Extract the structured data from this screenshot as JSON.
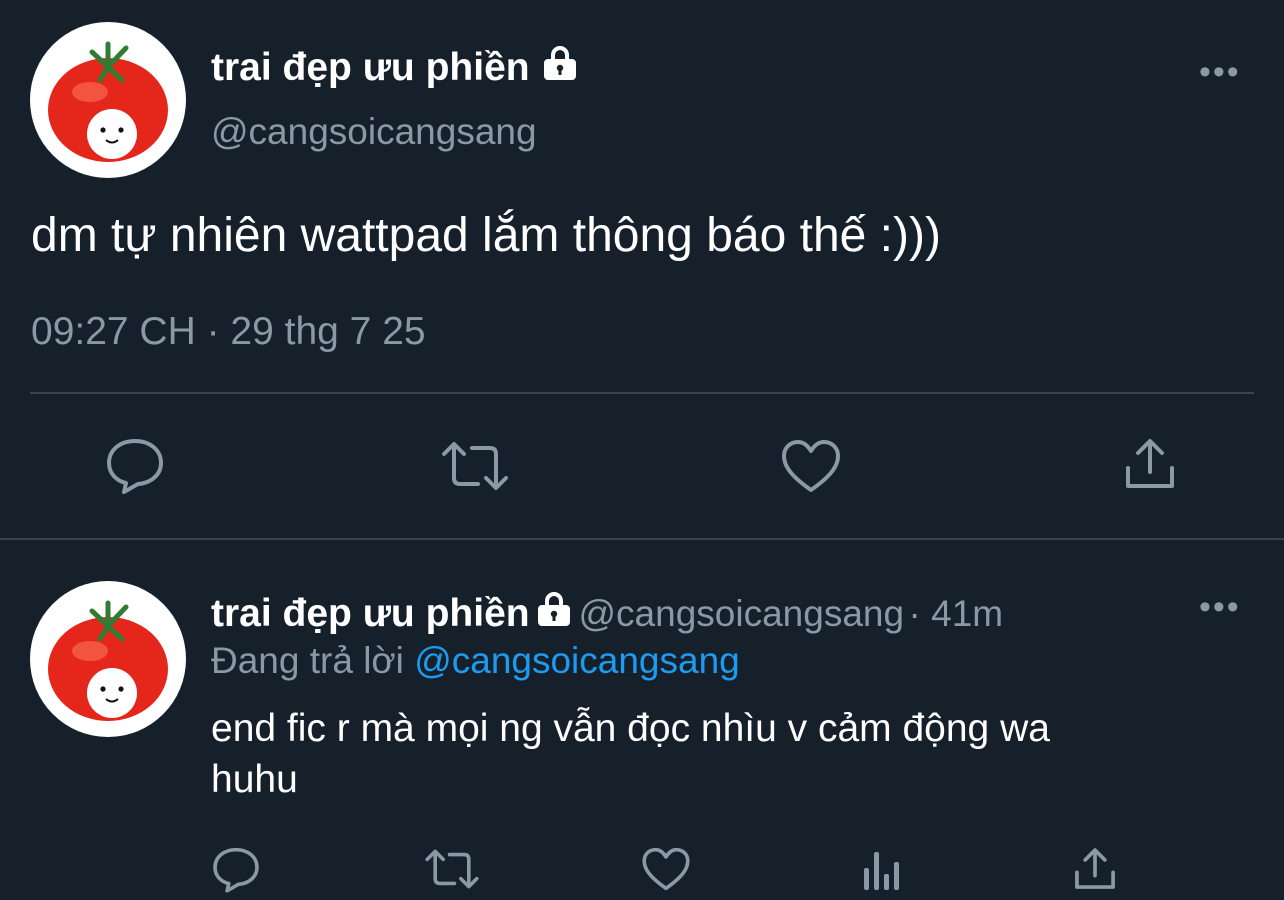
{
  "main_tweet": {
    "display_name": "trai đẹp ưu phiền",
    "handle": "@cangsoicangsang",
    "text": "dm tự nhiên wattpad lắm thông báo thế :)))",
    "timestamp": "09:27 CH · 29 thg 7 25",
    "more_icon": "more-dots-icon",
    "actions": [
      "reply-icon",
      "retweet-icon",
      "like-icon",
      "share-icon"
    ]
  },
  "reply_tweet": {
    "display_name": "trai đẹp ưu phiền",
    "handle": "@cangsoicangsang",
    "time_ago": "· 41m",
    "replying_to_label": "Đang trả lời",
    "replying_to_handle": "@cangsoicangsang",
    "text_line1": "end fic r mà mọi ng vẫn đọc nhìu v cảm động wa",
    "text_line2": "huhu",
    "actions": [
      "reply-icon",
      "retweet-icon",
      "like-icon",
      "analytics-icon",
      "share-icon"
    ]
  },
  "colors": {
    "background": "#15202b",
    "text": "#ffffff",
    "muted": "#8b98a5",
    "link": "#1d9bf0",
    "divider": "#38444d"
  }
}
